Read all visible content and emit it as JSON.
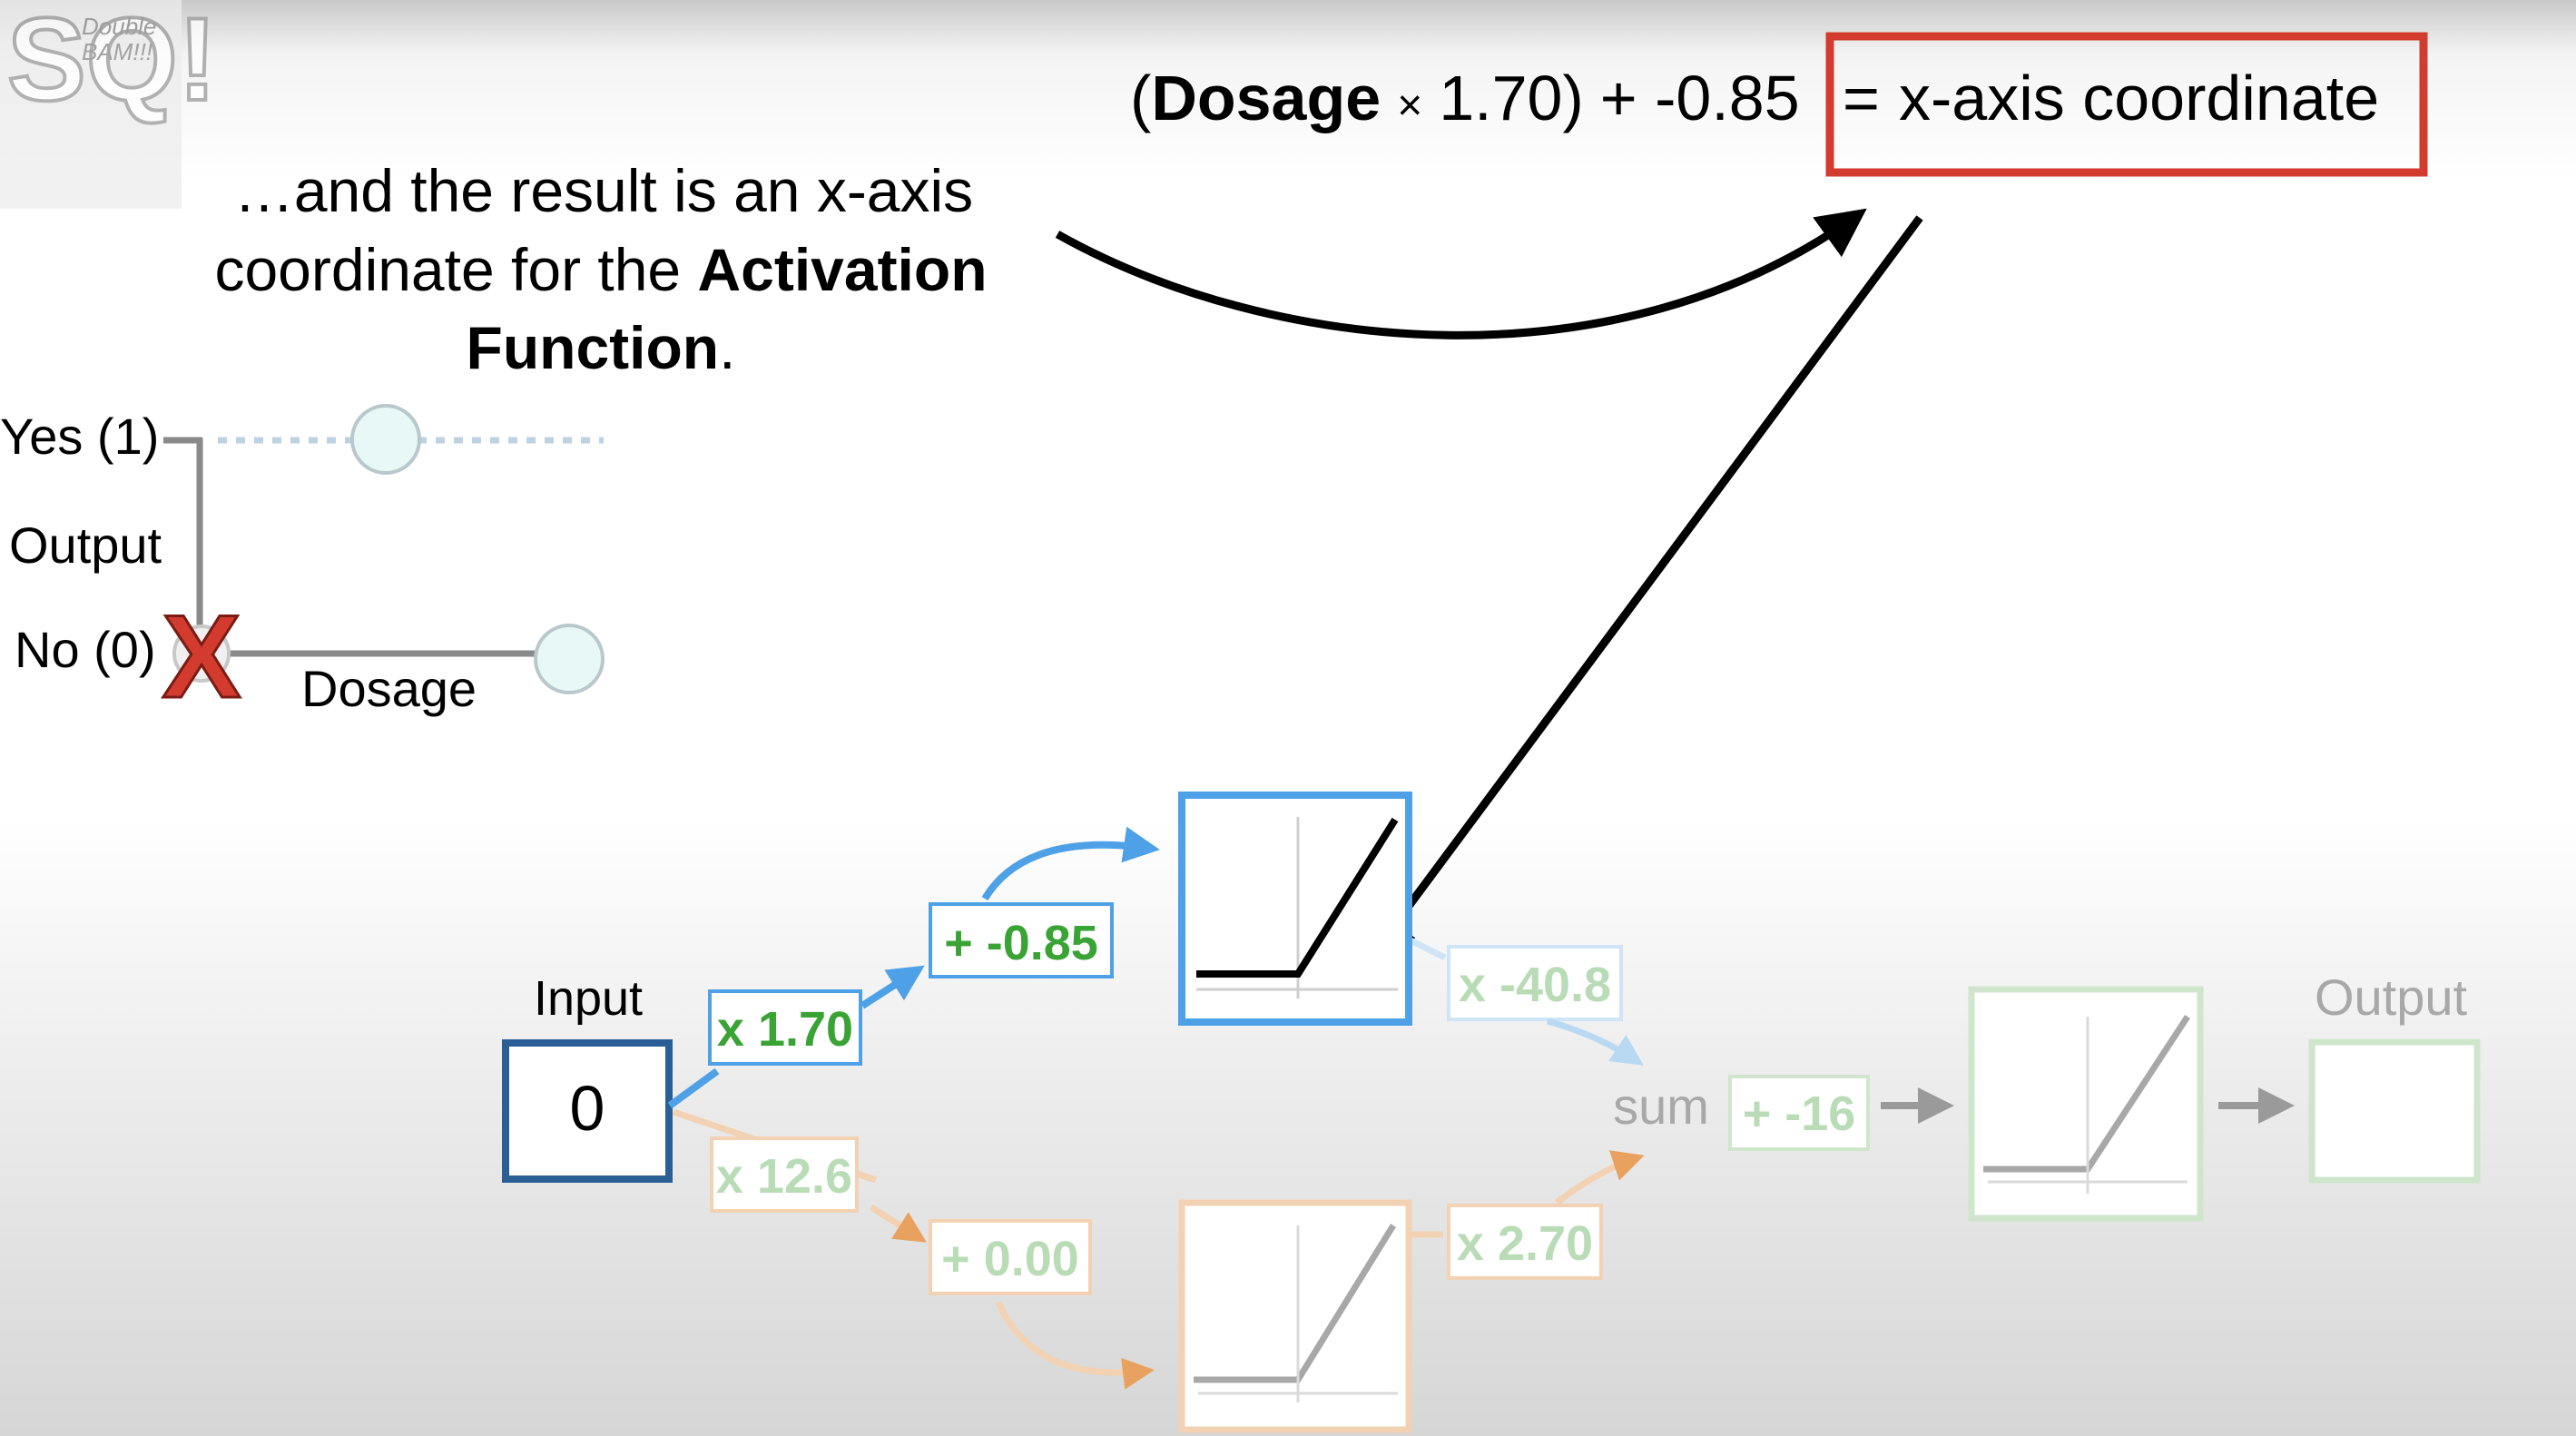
{
  "logo": {
    "line1": "Double",
    "line2": "BAM!!!",
    "mark": "SQ!"
  },
  "equation": {
    "open_paren": "(",
    "term": "Dosage",
    "times": "×",
    "weight": "1.70)",
    "plus_bias": "+ -0.85",
    "equals": "=",
    "result": "x-axis coordinate"
  },
  "caption": {
    "line1": "…and the result is an x-axis",
    "line2_plain": "coordinate for the ",
    "line2_bold": "Activation",
    "line3_bold": "Function",
    "line3_end": "."
  },
  "mini_graph": {
    "yes_label": "Yes (1)",
    "output_label": "Output",
    "no_label": "No (0)",
    "dosage_label": "Dosage",
    "marker": "X"
  },
  "network": {
    "input_title": "Input",
    "input_value": "0",
    "top_weight": "x 1.70",
    "top_bias": "+ -0.85",
    "top_out_weight": "x -40.8",
    "bottom_weight": "x 12.6",
    "bottom_bias": "+ 0.00",
    "bottom_out_weight": "x 2.70",
    "sum_label": "sum",
    "final_bias": "+ -16",
    "output_title": "Output"
  },
  "colors": {
    "highlight": "#d23b2e",
    "blue": "#4ea1e6",
    "dark_blue": "#2b5e94",
    "green": "#3aa336",
    "orange": "#e8a15f"
  }
}
